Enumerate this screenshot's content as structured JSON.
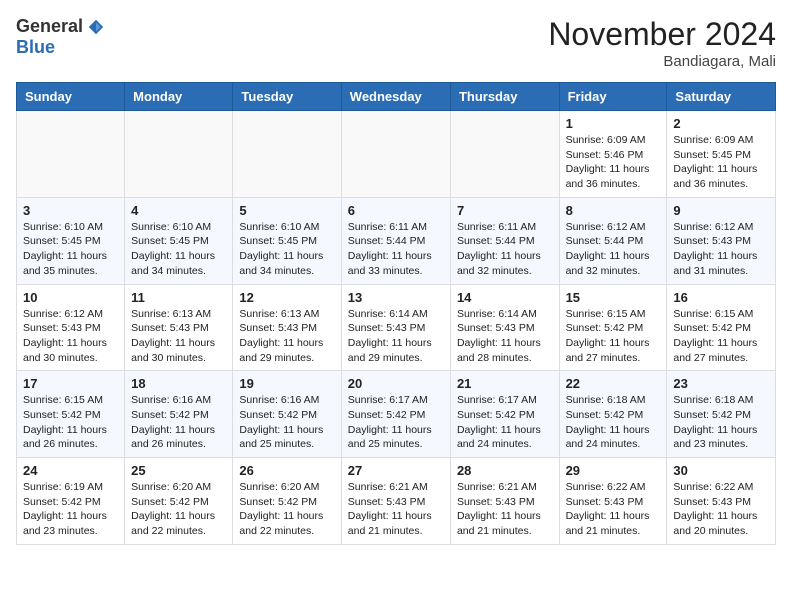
{
  "header": {
    "logo_general": "General",
    "logo_blue": "Blue",
    "month_title": "November 2024",
    "location": "Bandiagara, Mali"
  },
  "weekdays": [
    "Sunday",
    "Monday",
    "Tuesday",
    "Wednesday",
    "Thursday",
    "Friday",
    "Saturday"
  ],
  "weeks": [
    [
      {
        "day": "",
        "info": ""
      },
      {
        "day": "",
        "info": ""
      },
      {
        "day": "",
        "info": ""
      },
      {
        "day": "",
        "info": ""
      },
      {
        "day": "",
        "info": ""
      },
      {
        "day": "1",
        "info": "Sunrise: 6:09 AM\nSunset: 5:46 PM\nDaylight: 11 hours\nand 36 minutes."
      },
      {
        "day": "2",
        "info": "Sunrise: 6:09 AM\nSunset: 5:45 PM\nDaylight: 11 hours\nand 36 minutes."
      }
    ],
    [
      {
        "day": "3",
        "info": "Sunrise: 6:10 AM\nSunset: 5:45 PM\nDaylight: 11 hours\nand 35 minutes."
      },
      {
        "day": "4",
        "info": "Sunrise: 6:10 AM\nSunset: 5:45 PM\nDaylight: 11 hours\nand 34 minutes."
      },
      {
        "day": "5",
        "info": "Sunrise: 6:10 AM\nSunset: 5:45 PM\nDaylight: 11 hours\nand 34 minutes."
      },
      {
        "day": "6",
        "info": "Sunrise: 6:11 AM\nSunset: 5:44 PM\nDaylight: 11 hours\nand 33 minutes."
      },
      {
        "day": "7",
        "info": "Sunrise: 6:11 AM\nSunset: 5:44 PM\nDaylight: 11 hours\nand 32 minutes."
      },
      {
        "day": "8",
        "info": "Sunrise: 6:12 AM\nSunset: 5:44 PM\nDaylight: 11 hours\nand 32 minutes."
      },
      {
        "day": "9",
        "info": "Sunrise: 6:12 AM\nSunset: 5:43 PM\nDaylight: 11 hours\nand 31 minutes."
      }
    ],
    [
      {
        "day": "10",
        "info": "Sunrise: 6:12 AM\nSunset: 5:43 PM\nDaylight: 11 hours\nand 30 minutes."
      },
      {
        "day": "11",
        "info": "Sunrise: 6:13 AM\nSunset: 5:43 PM\nDaylight: 11 hours\nand 30 minutes."
      },
      {
        "day": "12",
        "info": "Sunrise: 6:13 AM\nSunset: 5:43 PM\nDaylight: 11 hours\nand 29 minutes."
      },
      {
        "day": "13",
        "info": "Sunrise: 6:14 AM\nSunset: 5:43 PM\nDaylight: 11 hours\nand 29 minutes."
      },
      {
        "day": "14",
        "info": "Sunrise: 6:14 AM\nSunset: 5:43 PM\nDaylight: 11 hours\nand 28 minutes."
      },
      {
        "day": "15",
        "info": "Sunrise: 6:15 AM\nSunset: 5:42 PM\nDaylight: 11 hours\nand 27 minutes."
      },
      {
        "day": "16",
        "info": "Sunrise: 6:15 AM\nSunset: 5:42 PM\nDaylight: 11 hours\nand 27 minutes."
      }
    ],
    [
      {
        "day": "17",
        "info": "Sunrise: 6:15 AM\nSunset: 5:42 PM\nDaylight: 11 hours\nand 26 minutes."
      },
      {
        "day": "18",
        "info": "Sunrise: 6:16 AM\nSunset: 5:42 PM\nDaylight: 11 hours\nand 26 minutes."
      },
      {
        "day": "19",
        "info": "Sunrise: 6:16 AM\nSunset: 5:42 PM\nDaylight: 11 hours\nand 25 minutes."
      },
      {
        "day": "20",
        "info": "Sunrise: 6:17 AM\nSunset: 5:42 PM\nDaylight: 11 hours\nand 25 minutes."
      },
      {
        "day": "21",
        "info": "Sunrise: 6:17 AM\nSunset: 5:42 PM\nDaylight: 11 hours\nand 24 minutes."
      },
      {
        "day": "22",
        "info": "Sunrise: 6:18 AM\nSunset: 5:42 PM\nDaylight: 11 hours\nand 24 minutes."
      },
      {
        "day": "23",
        "info": "Sunrise: 6:18 AM\nSunset: 5:42 PM\nDaylight: 11 hours\nand 23 minutes."
      }
    ],
    [
      {
        "day": "24",
        "info": "Sunrise: 6:19 AM\nSunset: 5:42 PM\nDaylight: 11 hours\nand 23 minutes."
      },
      {
        "day": "25",
        "info": "Sunrise: 6:20 AM\nSunset: 5:42 PM\nDaylight: 11 hours\nand 22 minutes."
      },
      {
        "day": "26",
        "info": "Sunrise: 6:20 AM\nSunset: 5:42 PM\nDaylight: 11 hours\nand 22 minutes."
      },
      {
        "day": "27",
        "info": "Sunrise: 6:21 AM\nSunset: 5:43 PM\nDaylight: 11 hours\nand 21 minutes."
      },
      {
        "day": "28",
        "info": "Sunrise: 6:21 AM\nSunset: 5:43 PM\nDaylight: 11 hours\nand 21 minutes."
      },
      {
        "day": "29",
        "info": "Sunrise: 6:22 AM\nSunset: 5:43 PM\nDaylight: 11 hours\nand 21 minutes."
      },
      {
        "day": "30",
        "info": "Sunrise: 6:22 AM\nSunset: 5:43 PM\nDaylight: 11 hours\nand 20 minutes."
      }
    ]
  ]
}
